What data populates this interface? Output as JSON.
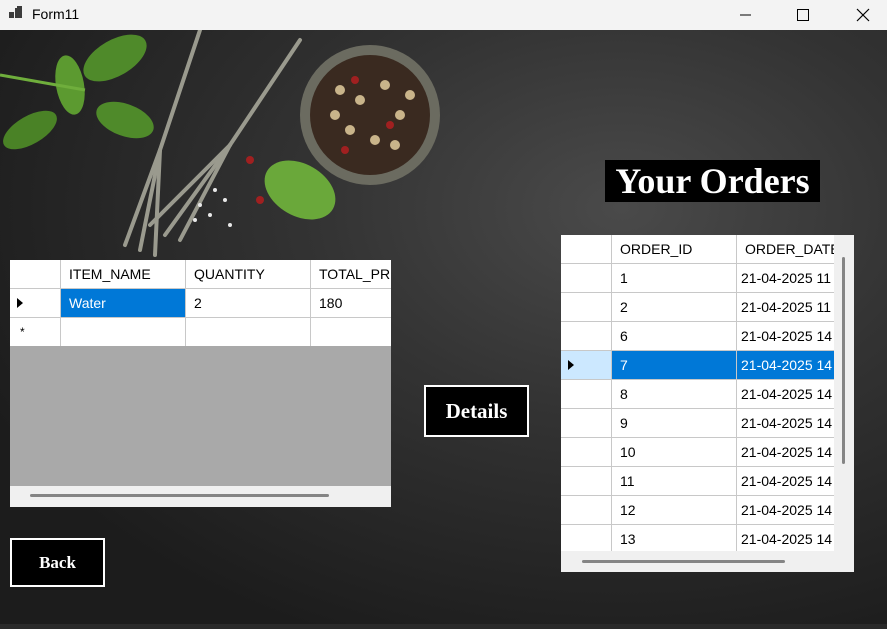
{
  "window": {
    "title": "Form11"
  },
  "heading": "Your Orders",
  "buttons": {
    "details": "Details",
    "back": "Back"
  },
  "items_grid": {
    "columns": [
      "ITEM_NAME",
      "QUANTITY",
      "TOTAL_PRIC"
    ],
    "rows": [
      [
        "Water",
        "2",
        "180"
      ]
    ],
    "new_row_marker": "*"
  },
  "orders_grid": {
    "columns": [
      "ORDER_ID",
      "ORDER_DATE"
    ],
    "rows": [
      [
        "1",
        "21-04-2025 11"
      ],
      [
        "2",
        "21-04-2025 11"
      ],
      [
        "6",
        "21-04-2025 14"
      ],
      [
        "7",
        "21-04-2025 14"
      ],
      [
        "8",
        "21-04-2025 14"
      ],
      [
        "9",
        "21-04-2025 14"
      ],
      [
        "10",
        "21-04-2025 14"
      ],
      [
        "11",
        "21-04-2025 14"
      ],
      [
        "12",
        "21-04-2025 14"
      ],
      [
        "13",
        "21-04-2025 14"
      ]
    ],
    "selected_row": 3
  }
}
